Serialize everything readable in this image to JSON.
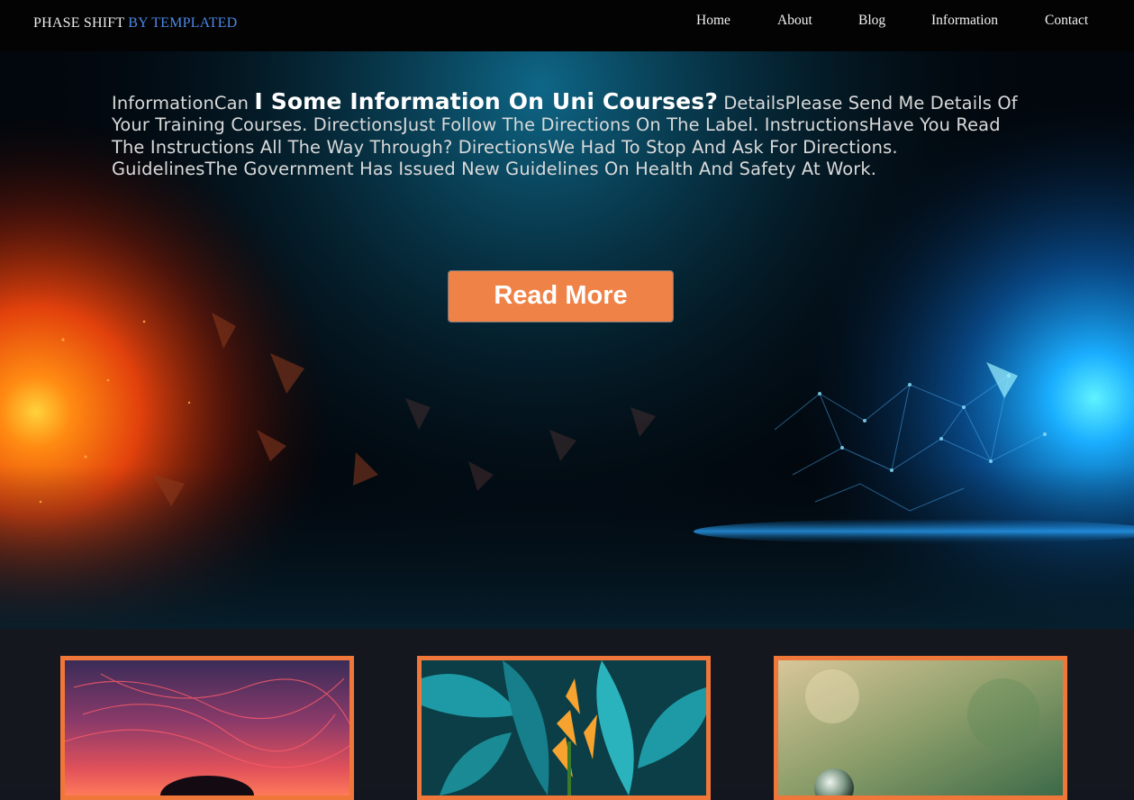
{
  "brand": {
    "part1": "PHASE SHIFT",
    "part2": "BY TEMPLATED"
  },
  "nav": {
    "items": [
      "Home",
      "About",
      "Blog",
      "Information",
      "Contact"
    ]
  },
  "hero": {
    "pre": "InformationCan",
    "heading": "I Some Information On Uni Courses?",
    "body": "DetailsPlease Send Me Details Of Your Training Courses. DirectionsJust Follow The Directions On The Label. InstructionsHave You Read The Instructions All The Way Through? DirectionsWe Had To Stop And Ask For Directions. GuidelinesThe Government Has Issued New Guidelines On Health And Safety At Work.",
    "button": "Read More"
  },
  "colors": {
    "accent": "#ef8246",
    "card_border": "#f0773a",
    "brand_blue": "#4a88e6"
  }
}
